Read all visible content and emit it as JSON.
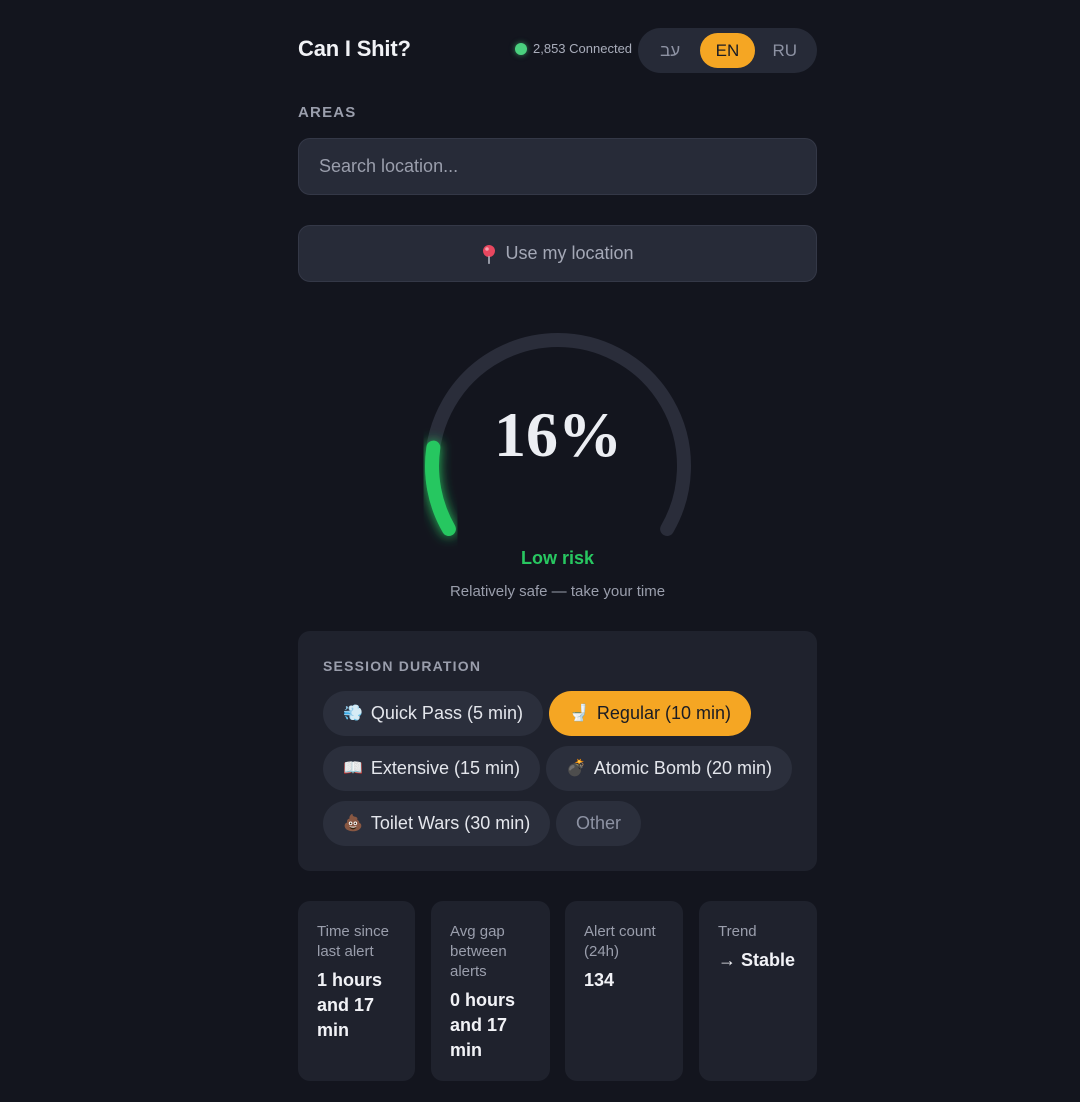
{
  "header": {
    "title": "Can I Shit?",
    "connected_text": "2,853 Connected",
    "languages": [
      {
        "code": "עב",
        "active": false
      },
      {
        "code": "EN",
        "active": true
      },
      {
        "code": "RU",
        "active": false
      }
    ]
  },
  "areas": {
    "label": "AREAS",
    "search_placeholder": "Search location...",
    "search_value": "",
    "location_button": "Use my location"
  },
  "gauge": {
    "value_text": "16%",
    "value": 16,
    "risk_label": "Low risk",
    "risk_sub": "Relatively safe — take your time",
    "accent_color": "#28c761",
    "track_color": "#2a2d3a"
  },
  "session": {
    "title": "SESSION DURATION",
    "options": [
      {
        "emoji": "💨",
        "label": "Quick Pass (5 min)",
        "active": false
      },
      {
        "emoji": "🚽",
        "label": "Regular (10 min)",
        "active": true
      },
      {
        "emoji": "📖",
        "label": "Extensive (15 min)",
        "active": false
      },
      {
        "emoji": "💣",
        "label": "Atomic Bomb (20 min)",
        "active": false
      },
      {
        "emoji": "💩",
        "label": "Toilet Wars (30 min)",
        "active": false
      },
      {
        "emoji": "",
        "label": "Other",
        "active": false
      }
    ]
  },
  "stats": [
    {
      "label": "Time since last alert",
      "value": "1 hours and 17 min"
    },
    {
      "label": "Avg gap between alerts",
      "value": "0 hours and 17 min"
    },
    {
      "label": "Alert count (24h)",
      "value": "134"
    },
    {
      "label": "Trend",
      "value": "→ Stable"
    }
  ],
  "colors": {
    "background": "#13151e",
    "card": "#1f222d",
    "accent_orange": "#f5a623",
    "connected_dot": "#4ad07e"
  }
}
